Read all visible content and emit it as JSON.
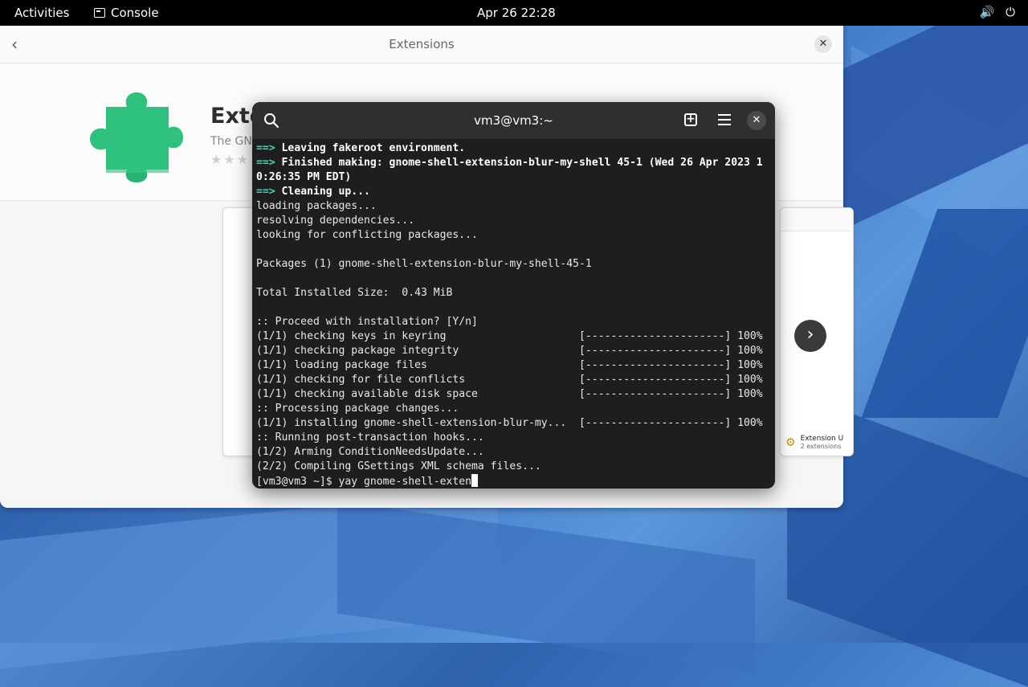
{
  "topbar": {
    "activities": "Activities",
    "app_name": "Console",
    "clock": "Apr 26  22:28",
    "volume_icon": "🔊",
    "power_icon": "⏻"
  },
  "extensions_app": {
    "title": "Extensions",
    "name": "Exte",
    "subtitle": "The GN",
    "stars": "★★★",
    "update_card": {
      "title": "Extension U",
      "subtitle": "2 extensions"
    },
    "accent_color": "#2ec27e"
  },
  "terminal": {
    "title": "vm3@vm3:~",
    "lines": [
      {
        "arrow": "==> ",
        "text": "Leaving fakeroot environment.",
        "bold": true
      },
      {
        "arrow": "==> ",
        "text": "Finished making: gnome-shell-extension-blur-my-shell 45-1 (Wed 26 Apr 2023 1",
        "bold": true
      },
      {
        "arrow": "",
        "text": "0:26:35 PM EDT)",
        "bold": true
      },
      {
        "arrow": "==> ",
        "text": "Cleaning up...",
        "bold": true
      },
      {
        "arrow": "",
        "text": "loading packages...",
        "bold": false
      },
      {
        "arrow": "",
        "text": "resolving dependencies...",
        "bold": false
      },
      {
        "arrow": "",
        "text": "looking for conflicting packages...",
        "bold": false
      },
      {
        "arrow": "",
        "text": "",
        "bold": false
      },
      {
        "arrow": "",
        "text": "Packages (1) gnome-shell-extension-blur-my-shell-45-1",
        "bold": false
      },
      {
        "arrow": "",
        "text": "",
        "bold": false
      },
      {
        "arrow": "",
        "text": "Total Installed Size:  0.43 MiB",
        "bold": false
      },
      {
        "arrow": "",
        "text": "",
        "bold": false
      },
      {
        "arrow": "",
        "text": ":: Proceed with installation? [Y/n]",
        "bold": false
      },
      {
        "arrow": "",
        "text": "(1/1) checking keys in keyring                     [----------------------] 100%",
        "bold": false
      },
      {
        "arrow": "",
        "text": "(1/1) checking package integrity                   [----------------------] 100%",
        "bold": false
      },
      {
        "arrow": "",
        "text": "(1/1) loading package files                        [----------------------] 100%",
        "bold": false
      },
      {
        "arrow": "",
        "text": "(1/1) checking for file conflicts                  [----------------------] 100%",
        "bold": false
      },
      {
        "arrow": "",
        "text": "(1/1) checking available disk space                [----------------------] 100%",
        "bold": false
      },
      {
        "arrow": "",
        "text": ":: Processing package changes...",
        "bold": false
      },
      {
        "arrow": "",
        "text": "(1/1) installing gnome-shell-extension-blur-my...  [----------------------] 100%",
        "bold": false
      },
      {
        "arrow": "",
        "text": ":: Running post-transaction hooks...",
        "bold": false
      },
      {
        "arrow": "",
        "text": "(1/2) Arming ConditionNeedsUpdate...",
        "bold": false
      },
      {
        "arrow": "",
        "text": "(2/2) Compiling GSettings XML schema files...",
        "bold": false
      }
    ],
    "prompt": "[vm3@vm3 ~]$ ",
    "input": "yay gnome-shell-exten"
  }
}
